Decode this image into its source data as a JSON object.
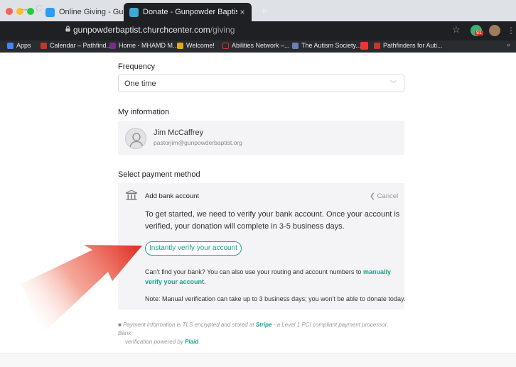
{
  "browser": {
    "tabs": [
      {
        "title": "Online Giving - Gunpowder Bapti",
        "active": false
      },
      {
        "title": "Donate - Gunpowder Baptist Chu",
        "active": true
      }
    ],
    "close_glyph": "×",
    "new_tab_glyph": "+",
    "url_host": "gunpowderbaptist.churchcenter.com",
    "url_path": "/giving",
    "ext_badge": "91",
    "bookmarks": [
      {
        "label": "Apps"
      },
      {
        "label": "Calendar – Pathfind..."
      },
      {
        "label": "Home - MHAMD M..."
      },
      {
        "label": "Welcome!"
      },
      {
        "label": "Abilities Network –..."
      },
      {
        "label": "The Autism Society..."
      },
      {
        "label": "Pathfinders for Auti..."
      }
    ],
    "overflow_glyph": "»"
  },
  "frequency": {
    "label": "Frequency",
    "value": "One time"
  },
  "my_info": {
    "label": "My information",
    "name": "Jim McCaffrey",
    "email": "pastorjim@gunpowderbaptist.org"
  },
  "payment": {
    "label": "Select payment method",
    "add_bank_label": "Add bank account",
    "cancel_label": "Cancel",
    "intro_line1": "To get started, we need to verify your bank account. Once your account is",
    "intro_line2": "verified, your donation will complete in 3-5 business days.",
    "verify_button": "Instantly verify your account",
    "manual_prefix": "Can't find your bank? You can also use your routing and account numbers to",
    "manual_link1": "manually",
    "manual_link2": "verify your account",
    "manual_suffix": ".",
    "note": "Note: Manual verification can take up to 3 business days; you won't be able to donate today."
  },
  "footnote": {
    "part1": "Payment information is TLS encrypted and stored at",
    "stripe": "Stripe",
    "part2": "- a Level 1 PCI compliant payment processor. Bank",
    "part3": "verification powered by",
    "plaid": "Plaid",
    "part4": "."
  },
  "colors": {
    "accent": "#14a38b",
    "panel": "#f4f4f6",
    "annotation_arrow": "#e0261b"
  }
}
